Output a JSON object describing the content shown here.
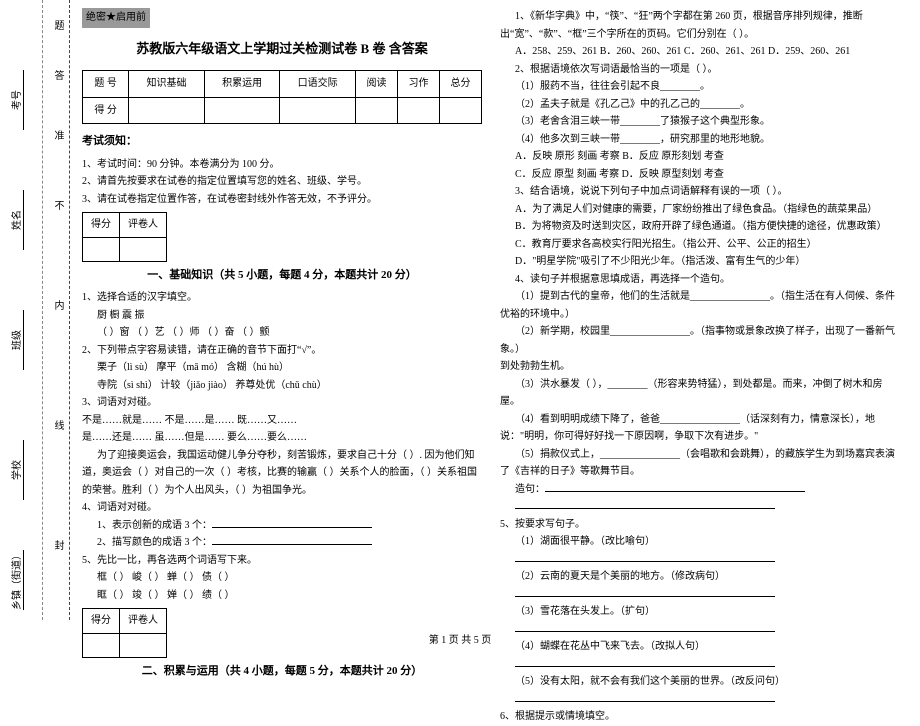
{
  "binding": {
    "township": "乡镇（街道）",
    "school": "学校",
    "class": "班级",
    "name": "姓名",
    "seat": "考号",
    "seal": "封",
    "line": "线",
    "inside": "内",
    "no": "不",
    "quasi": "准",
    "answer": "答",
    "question": "题"
  },
  "secret": "绝密★启用前",
  "title": "苏教版六年级语文上学期过关检测试卷 B 卷  含答案",
  "scoretable": {
    "headers": [
      "题  号",
      "知识基础",
      "积累运用",
      "口语交际",
      "阅读",
      "习作",
      "总分"
    ],
    "rowlabel": "得  分"
  },
  "notice_head": "考试须知：",
  "notice": [
    "1、考试时间：90 分钟。本卷满分为 100 分。",
    "2、请首先按要求在试卷的指定位置填写您的姓名、班级、学号。",
    "3、请在试卷指定位置作答，在试卷密封线外作答无效，不予评分。"
  ],
  "mini": {
    "c1": "得分",
    "c2": "评卷人"
  },
  "sec1": "一、基础知识（共 5 小题，每题 4 分，本题共计 20 分）",
  "q1": {
    "stem": "1、选择合适的汉字填空。",
    "row1": "厨           橱               震           振",
    "row2": "（    ）窗   （    ）艺   （    ）师   （    ）奋   （    ）颤"
  },
  "q2": {
    "stem": "2、下列带点字容易读错，请在正确的音节下面打“√”。",
    "l1": "栗子（lì  sù）        摩平（mā  mó）        含糊（hú  hù）",
    "l2": "寺院（sì  shì）       计较（jiǎo  jiào）      养尊处优（chǔ  chù）"
  },
  "q3": {
    "stem": "3、词语对对碰。",
    "a": "    不是……就是……        不是……是……      既……又……",
    "b": "    是……还是……          虽……但是……      要么……要么……",
    "para": "为了迎接奥运会，我国运动健儿争分夺秒，刻苦锻炼，要求自己十分（    ）. 因为他们知道，奥运会（    ）对自己的一次（    ）考核，比赛的输赢（    ）关系个人的脸面，（    ）关系祖国的荣誉。胜利（    ）为个人出风头，（    ）为祖国争光。"
  },
  "q4": {
    "stem": "4、词语对对碰。",
    "l1": "1、表示创新的成语 3 个：",
    "l2": "2、描写颜色的成语 3 个："
  },
  "q5": {
    "stem": "5、先比一比，再各选两个词语写下来。",
    "l1": "框（    ）       峻（    ）       蝉（    ）       债（    ）",
    "l2": "眶（    ）       竣（    ）       婵（    ）       绩（    ）"
  },
  "sec2": "二、积累与运用（共 4 小题，每题 5 分，本题共计 20 分）",
  "r1": {
    "stem": "1、《新华字典》中，“筷”、“狂”两个字都在第 260 页，根据音序排列规律，推断出“宽”、“款”、“框”三个字所在的页码。它们分别在（        ）。",
    "A": "A．258、259、261    B．260、260、261    C．260、261、261    D．259、260、261"
  },
  "r2": {
    "stem": "2、根据语境依次写词语最恰当的一项是（        ）。",
    "l1": "（1）服药不当，往往会引起不良________。",
    "l2": "（2）孟夫子就是《孔乙己》中的孔乙己的________。",
    "l3": "（3）老舍含泪三峡一带________了猿猴子这个典型形象。",
    "l4": "（4）他多次到三峡一带________，研究那里的地形地貌。",
    "A": "A．反映   原形   刻画   考察        B．反应   原形刻划   考查",
    "B": "C．反应   原型   刻画   考察        D．反映   原型刻划   考查"
  },
  "r3": {
    "stem": "3、结合语境，说说下列句子中加点词语解释有误的一项（        ）。",
    "A": "A．为了满足人们对健康的需要，厂家纷纷推出了绿色食品。（指绿色的蔬菜果品）",
    "B": "B．为将物资及时送到灾区，政府开辟了绿色通道。（指方便快捷的途径，优惠政策）",
    "C": "C．教育厅要求各高校实行阳光招生。（指公开、公平、公正的招生）",
    "D": "D．\"明星学院\"吸引了不少阳光少年。（指活泼、富有生气的少年）"
  },
  "r4": {
    "stem": "4、读句子并根据意思填成语，再选择一个造句。",
    "l1": "（1）提到古代的皇帝，他们的生活就是________________。（指生活在有人伺候、条件优裕的环境中。）",
    "l2": "（2）新学期，校园里________________。（指事物或景象改换了样子，出现了一番新气象。）",
    "l3": "到处勃勃生机。",
    "l4": "（3）洪水暴发（    ），________（形容来势特猛），到处都是。而来，冲倒了树木和房屋。",
    "l5": "（4）看到明明成绩下降了，爸爸________________（话深刻有力，情意深长），地说：\"明明，你可得好好找一下原因啊，争取下次有进步。\"",
    "l6": "（5）捐款仪式上，________________（会唱歌和会跳舞），的藏族学生为到场嘉宾表演了《吉祥的日子》等歌舞节目。",
    "make": "造句："
  },
  "r5": {
    "stem": "5、按要求写句子。",
    "l1": "（1）湖面很平静。（改比喻句）",
    "l2": "（2）云南的夏天是个美丽的地方。（修改病句）",
    "l3": "（3）雪花落在头发上。（扩句）",
    "l4": "（4）蝴蝶在花丛中飞来飞去。（改拟人句）",
    "l5": "（5）没有太阳，就不会有我们这个美丽的世界。（改反问句）"
  },
  "r6": "6、根据提示或情境填空。",
  "footer": "第 1 页 共 5 页"
}
